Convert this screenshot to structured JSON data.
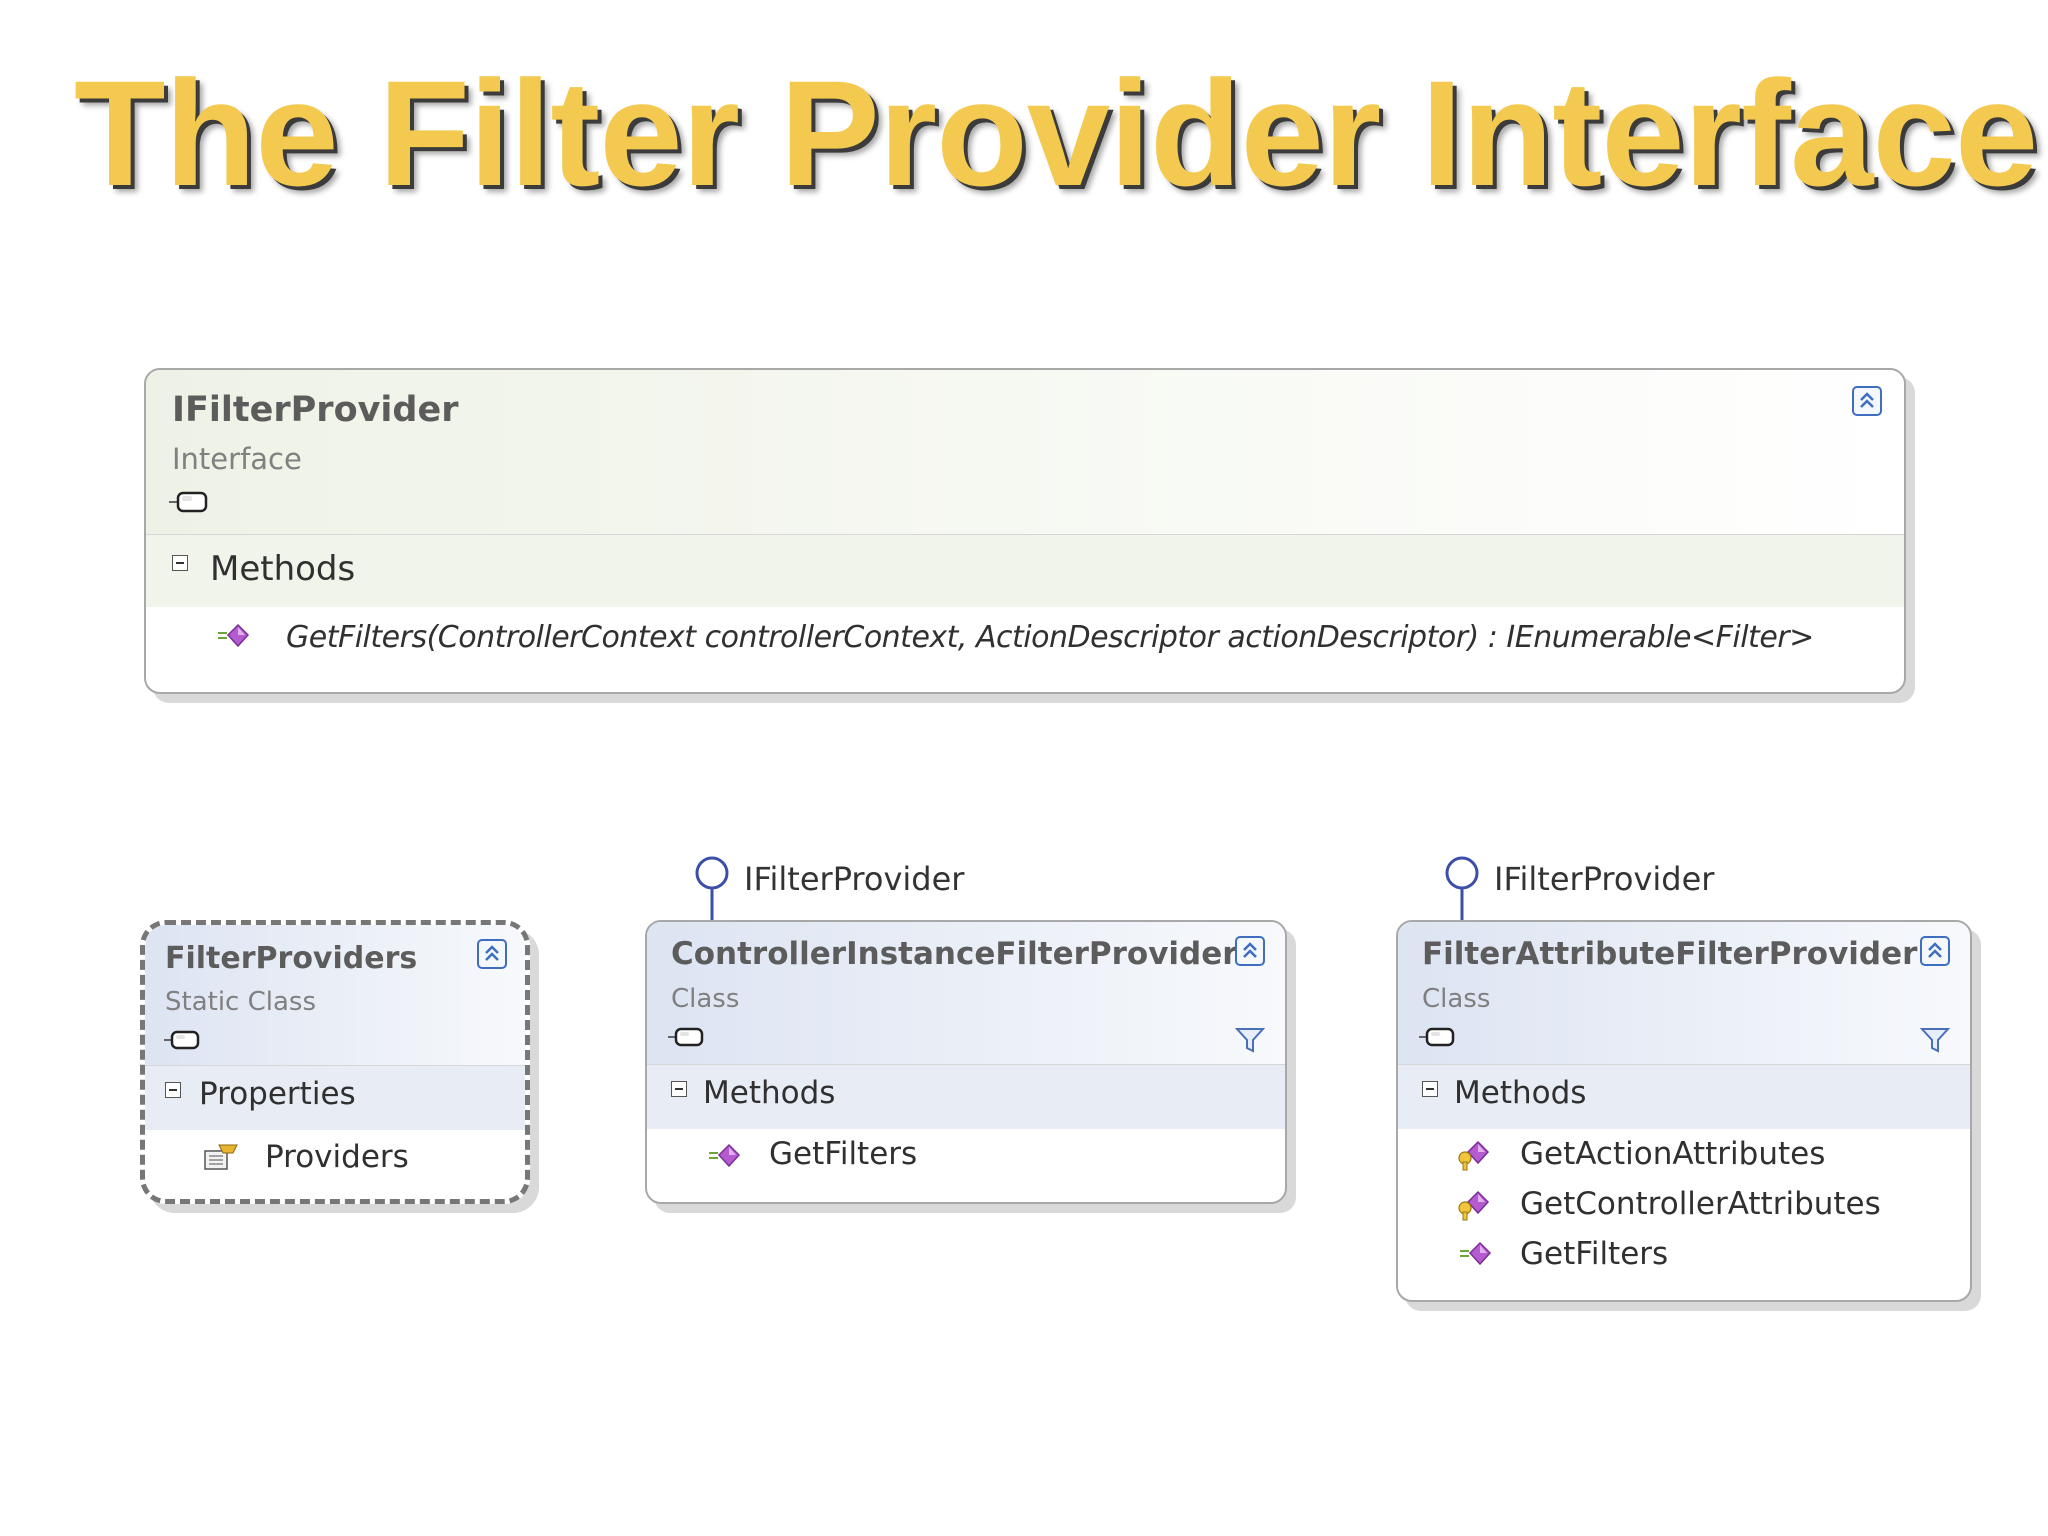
{
  "slide": {
    "title": "The Filter Provider Interface"
  },
  "interface_box": {
    "name": "IFilterProvider",
    "kind": "Interface",
    "section": "Methods",
    "method": "GetFilters(ControllerContext  controllerContext,  ActionDescriptor  actionDescriptor)  :  IEnumerable<Filter>"
  },
  "filter_providers_box": {
    "name": "FilterProviders",
    "kind": "Static Class",
    "section": "Properties",
    "members": [
      "Providers"
    ]
  },
  "controller_instance_box": {
    "implements": "IFilterProvider",
    "name": "ControllerInstanceFilterProvider",
    "kind": "Class",
    "section": "Methods",
    "members": [
      "GetFilters"
    ]
  },
  "filter_attribute_box": {
    "implements": "IFilterProvider",
    "name": "FilterAttributeFilterProvider",
    "kind": "Class",
    "section": "Methods",
    "members": [
      "GetActionAttributes",
      "GetControllerAttributes",
      "GetFilters"
    ]
  },
  "colors": {
    "title": "#f3c94f",
    "method_icon": "#b45ccf",
    "collapse_button": "#3f6ec0"
  }
}
